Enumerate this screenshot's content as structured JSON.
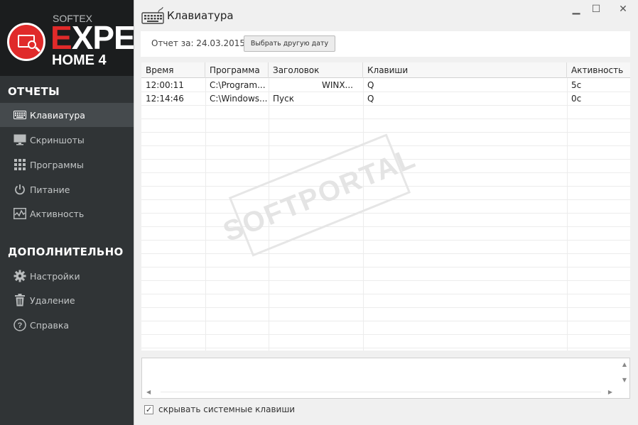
{
  "logo": {
    "softex": "SOFTEX",
    "expert_e": "E",
    "expert_rest": "XPERT",
    "home": "HOME 4"
  },
  "sidebar": {
    "section_reports": "ОТЧЕТЫ",
    "reports": [
      {
        "label": "Клавиатура",
        "icon": "keyboard-icon"
      },
      {
        "label": "Скриншоты",
        "icon": "monitor-icon"
      },
      {
        "label": "Программы",
        "icon": "apps-grid-icon"
      },
      {
        "label": "Питание",
        "icon": "power-icon"
      },
      {
        "label": "Активность",
        "icon": "activity-chart-icon"
      }
    ],
    "section_extra": "ДОПОЛНИТЕЛЬНО",
    "extra": [
      {
        "label": "Настройки",
        "icon": "gear-icon"
      },
      {
        "label": "Удаление",
        "icon": "trash-icon"
      },
      {
        "label": "Справка",
        "icon": "help-icon"
      }
    ]
  },
  "window": {
    "title": "Клавиатура",
    "minimize": "▁",
    "maximize": "☐",
    "close": "✕"
  },
  "datebar": {
    "label": "Отчет за: 24.03.2015",
    "button": "Выбрать другую дату"
  },
  "table": {
    "columns": [
      "Время",
      "Программа",
      "Заголовок",
      "Клавиши",
      "Активность"
    ],
    "rows": [
      [
        "12:00:11",
        "C:\\Program...",
        "WINX...",
        "Q",
        "5с"
      ],
      [
        "12:14:46",
        "C:\\Windows...",
        "Пуск",
        "Q",
        "0с"
      ]
    ]
  },
  "options": {
    "hide_system_keys": "скрывать системные клавиши",
    "checked": true
  },
  "watermark": {
    "text": "SOFTPORTAL"
  }
}
